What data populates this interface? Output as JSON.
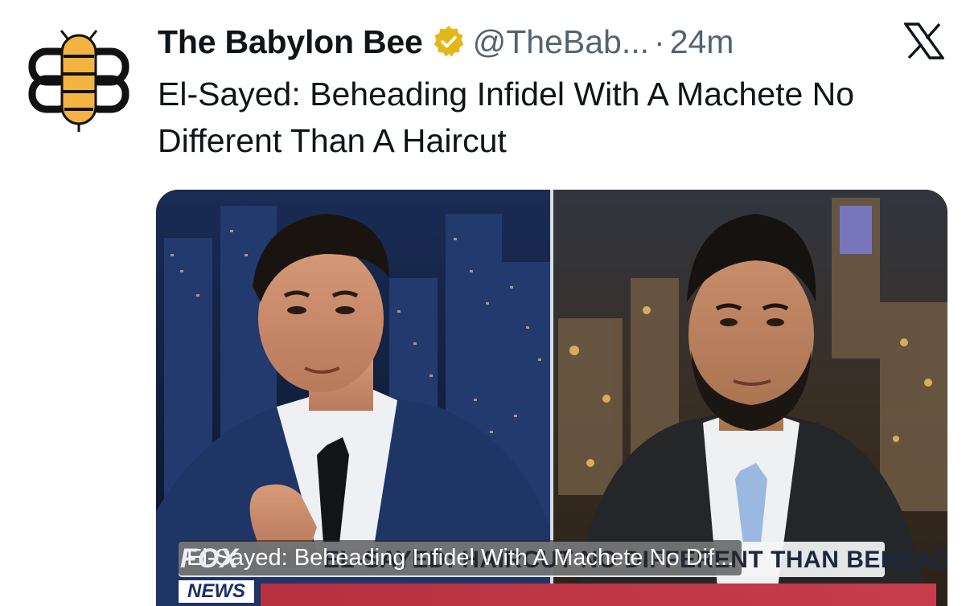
{
  "tweet": {
    "author_name": "The Babylon Bee",
    "handle": "@TheBab...",
    "separator": "·",
    "time": "24m",
    "text": "El-Sayed: Beheading Infidel With A Machete No Different Than A Haircut",
    "verified_badge_icon": "verified-gold-badge",
    "platform_icon": "x-logo-icon",
    "avatar_icon": "babylon-bee-logo"
  },
  "media": {
    "caption": "El-Sayed: Beheading Infidel With A Machete No Dif...",
    "chyron_text": "EL-SAYED: HAIRCUT NO DIFFERENT THAN BEHEADING",
    "network_logo_top": "FOX",
    "network_logo_bottom": "NEWS"
  },
  "colors": {
    "text_primary": "#0f1419",
    "text_secondary": "#536471",
    "badge_gold": "#e2b719",
    "bee_yellow": "#f2b340"
  }
}
